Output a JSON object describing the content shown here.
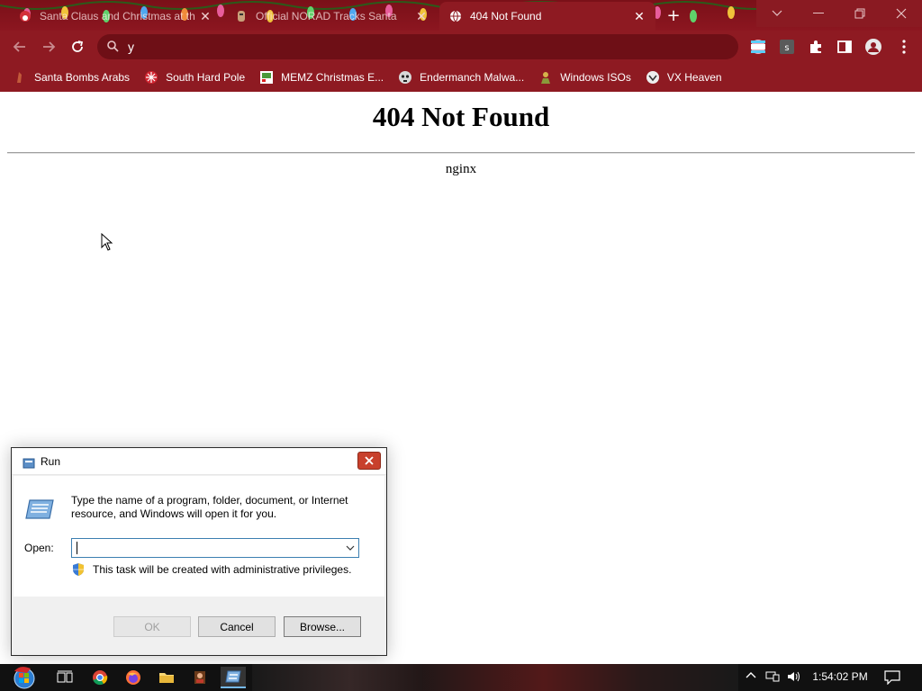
{
  "browser": {
    "tabs": [
      {
        "title": "Santa Claus and Christmas at th",
        "icon": "santa-favicon-icon",
        "active": false
      },
      {
        "title": "Official NORAD Tracks Santa",
        "icon": "norad-favicon-icon",
        "active": false
      },
      {
        "title": "404 Not Found",
        "icon": "globe-icon",
        "active": true
      }
    ],
    "new_tab_symbol": "+",
    "omnibox_text": "y",
    "bookmarks": [
      {
        "label": "Santa Bombs Arabs",
        "icon": "santa-favicon-icon"
      },
      {
        "label": "South Hard Pole",
        "icon": "snowflake-icon"
      },
      {
        "label": "MEMZ Christmas E...",
        "icon": "memz-icon"
      },
      {
        "label": "Endermanch Malwa...",
        "icon": "skull-icon"
      },
      {
        "label": "Windows ISOs",
        "icon": "windows-isos-icon"
      },
      {
        "label": "VX Heaven",
        "icon": "vx-heaven-icon"
      }
    ],
    "theme_color": "#8e1a22"
  },
  "page": {
    "heading": "404 Not Found",
    "server": "nginx"
  },
  "run_dialog": {
    "title": "Run",
    "description": "Type the name of a program, folder, document, or Internet resource, and Windows will open it for you.",
    "open_label": "Open:",
    "open_value": "",
    "admin_note": "This task will be created with administrative privileges.",
    "buttons": {
      "ok": "OK",
      "cancel": "Cancel",
      "browse": "Browse..."
    }
  },
  "taskbar": {
    "clock": "1:54:02 PM",
    "pinned": [
      "task-view-icon",
      "chrome-icon",
      "firefox-icon",
      "file-explorer-icon",
      "game-icon",
      "run-icon"
    ]
  }
}
